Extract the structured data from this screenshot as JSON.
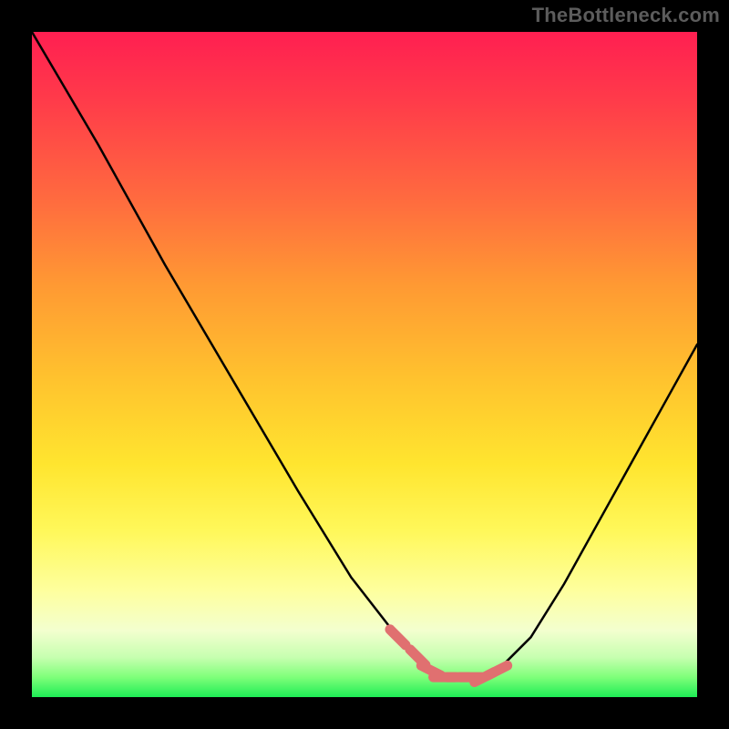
{
  "watermark": "TheBottleneck.com",
  "chart_data": {
    "type": "line",
    "title": "",
    "xlabel": "",
    "ylabel": "",
    "xlim": [
      0,
      100
    ],
    "ylim": [
      0,
      100
    ],
    "series": [
      {
        "name": "curve",
        "x": [
          0,
          10,
          20,
          30,
          40,
          48,
          55,
          60,
          62,
          65,
          68,
          70,
          75,
          80,
          85,
          90,
          95,
          100
        ],
        "values": [
          100,
          83,
          65,
          48,
          31,
          18,
          9,
          4,
          3,
          3,
          3,
          4,
          9,
          17,
          26,
          35,
          44,
          53
        ]
      }
    ],
    "markers": {
      "name": "highlight-segment",
      "color": "#e07070",
      "x": [
        55,
        58,
        60,
        62,
        64,
        66,
        68,
        70
      ],
      "values": [
        9,
        6,
        4,
        3,
        3,
        3,
        3,
        4
      ]
    },
    "gradient_axis": "y",
    "gradient_meaning": "high y = red (bad), low y = green (good)"
  }
}
